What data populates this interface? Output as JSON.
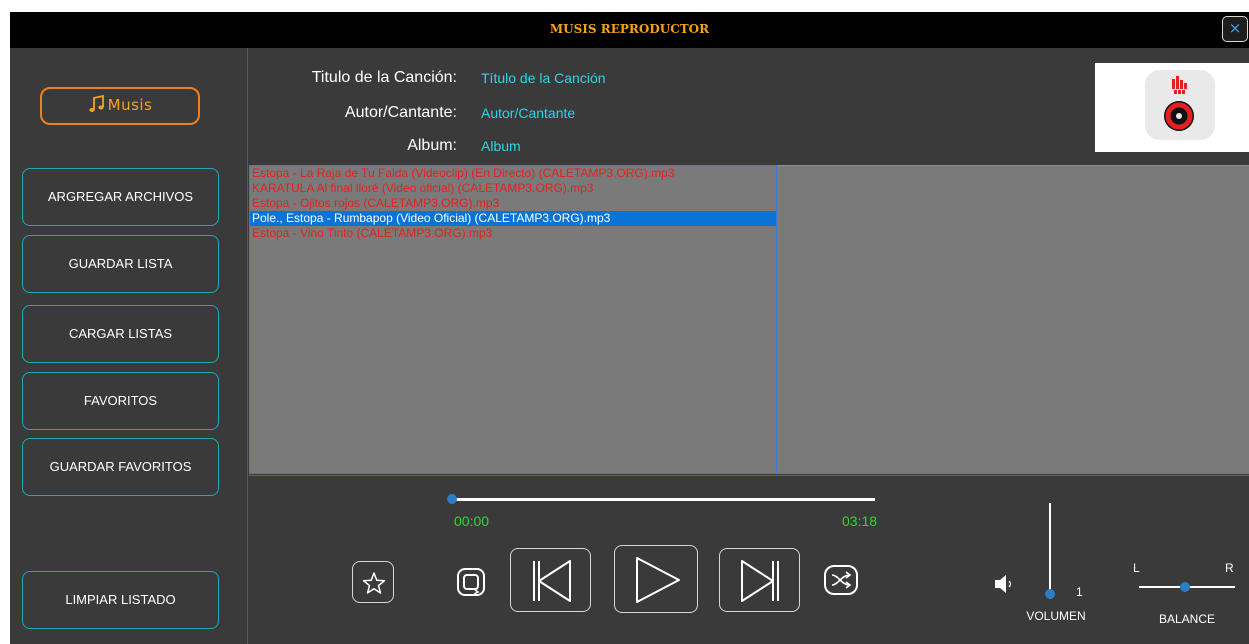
{
  "window": {
    "title": "MUSIS REPRODUCTOR",
    "close_glyph": "×"
  },
  "sidebar": {
    "logo_text": "Musis",
    "buttons": [
      "ARGREGAR ARCHIVOS",
      "GUARDAR LISTA",
      "CARGAR LISTAS",
      "FAVORITOS",
      "GUARDAR FAVORITOS",
      "LIMPIAR LISTADO"
    ]
  },
  "info": {
    "title_label": "Titulo de la Canción:",
    "title_value": "Título de la Canción",
    "author_label": "Autor/Cantante:",
    "author_value": "Autor/Cantante",
    "album_label": "Album:",
    "album_value": "Album"
  },
  "playlist": {
    "selected_index": 3,
    "tracks": [
      "Estopa - La Raja de Tu Falda (Videoclip) (En Directo) (CALETAMP3.ORG).mp3",
      "KARATULA Al final lloré (Video oficial) (CALETAMP3.ORG).mp3",
      "Estopa - Ojitos rojos (CALETAMP3.ORG).mp3",
      "Pole., Estopa - Rumbapop (Video Oficial) (CALETAMP3.ORG).mp3",
      "Estopa - Vino Tinto (CALETAMP3.ORG).mp3"
    ]
  },
  "player": {
    "current_time": "00:00",
    "total_time": "03:18",
    "progress_fraction": 0,
    "volume_value": "1",
    "volume_label": "VOLUMEN",
    "balance_left": "L",
    "balance_right": "R",
    "balance_label": "BALANCE",
    "icons": [
      "star-icon",
      "repeat-icon",
      "previous-icon",
      "play-icon",
      "next-icon",
      "shuffle-icon",
      "speaker-icon"
    ]
  },
  "colors": {
    "accent_orange": "#f07f1f",
    "title_orange": "#f4a21a",
    "teal_border": "#1faab9",
    "info_value": "#2ed3ea",
    "track_text": "#e52020",
    "selected_bg": "#0a74d6",
    "time_green": "#36d236",
    "knob_blue": "#2a7ec6"
  }
}
